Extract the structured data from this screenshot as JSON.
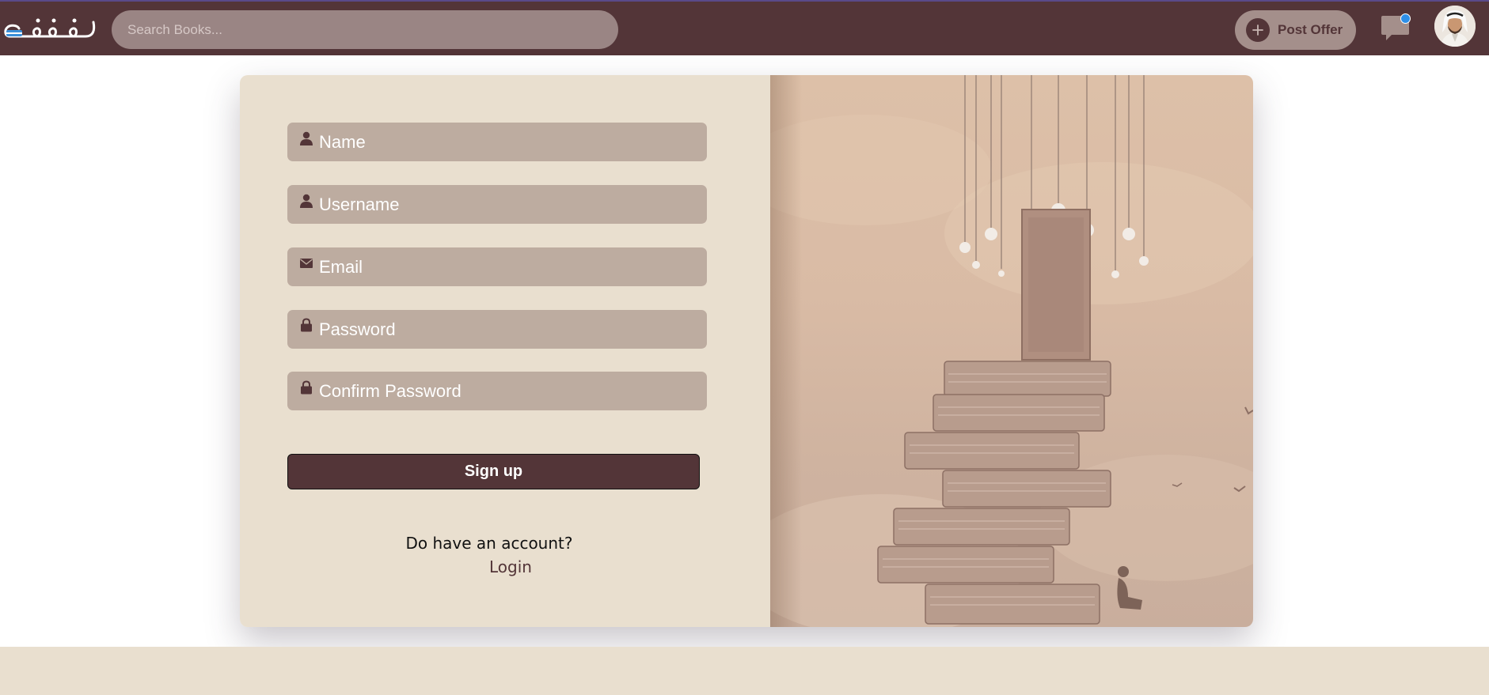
{
  "header": {
    "logo_text": "رفوف",
    "search": {
      "placeholder": "Search Books...",
      "value": ""
    },
    "post_offer_label": "Post Offer",
    "chat_notification": true
  },
  "signup_form": {
    "fields": [
      {
        "icon": "person-icon",
        "placeholder": "Name"
      },
      {
        "icon": "person-icon",
        "placeholder": "Username"
      },
      {
        "icon": "envelope-icon",
        "placeholder": "Email"
      },
      {
        "icon": "lock-icon",
        "placeholder": "Password"
      },
      {
        "icon": "lock-icon",
        "placeholder": "Confirm Password"
      }
    ],
    "submit_label": "Sign up",
    "account_prompt": "Do have an account?",
    "login_label": "Login"
  },
  "colors": {
    "brand": "#533538",
    "form_bg": "#e9dfcf",
    "field_bg": "#bdaca0",
    "notification": "#2e8fe8"
  }
}
